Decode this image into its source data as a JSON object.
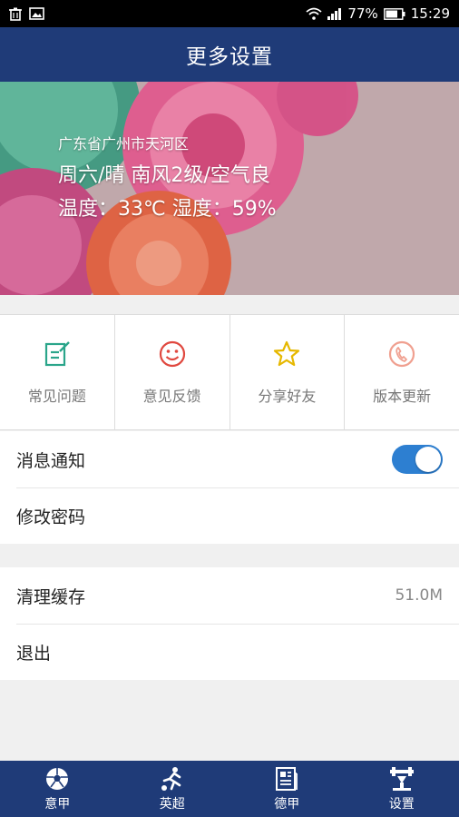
{
  "status_bar": {
    "battery": "77%",
    "time": "15:29"
  },
  "header": {
    "title": "更多设置"
  },
  "weather": {
    "location": "广东省广州市天河区",
    "condition": "周六/晴 南风2级/空气良",
    "temp_humidity": "温度：33℃ 湿度：59%"
  },
  "grid": [
    {
      "label": "常见问题",
      "icon": "faq-edit-icon",
      "color": "#2aa58a"
    },
    {
      "label": "意见反馈",
      "icon": "smiley-icon",
      "color": "#e0483f"
    },
    {
      "label": "分享好友",
      "icon": "star-icon",
      "color": "#e6b800"
    },
    {
      "label": "版本更新",
      "icon": "update-phone-icon",
      "color": "#f0a090"
    }
  ],
  "settings": {
    "notifications_label": "消息通知",
    "notifications_on": true,
    "change_password_label": "修改密码",
    "clear_cache_label": "清理缓存",
    "cache_size": "51.0M",
    "logout_label": "退出"
  },
  "bottom_nav": [
    {
      "label": "意甲",
      "icon": "soccer-ball-icon"
    },
    {
      "label": "英超",
      "icon": "player-kick-icon"
    },
    {
      "label": "德甲",
      "icon": "newspaper-icon"
    },
    {
      "label": "设置",
      "icon": "settings-tool-icon"
    }
  ],
  "colors": {
    "primary": "#1f3b78",
    "toggle_on": "#2d7fd1"
  }
}
